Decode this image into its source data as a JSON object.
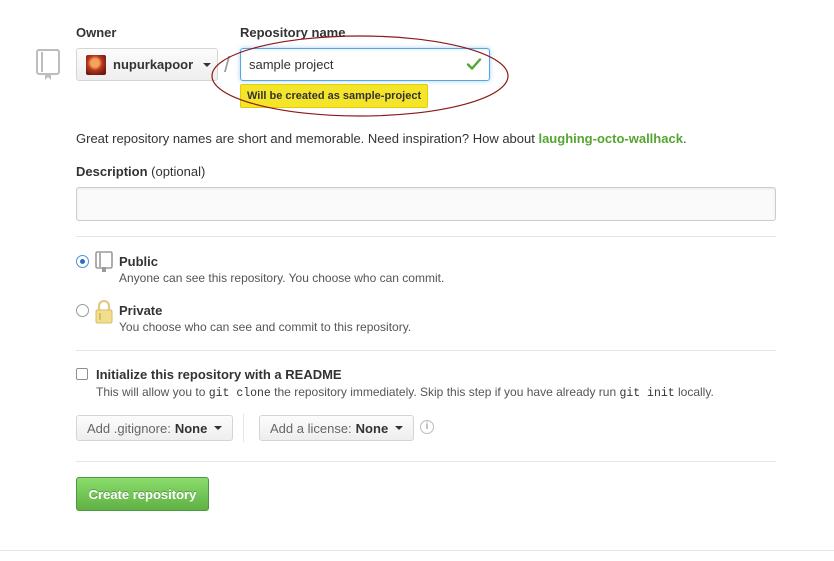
{
  "owner": {
    "label": "Owner",
    "selected": "nupurkapoor"
  },
  "repository_name": {
    "label": "Repository name",
    "value": "sample project",
    "hint": "Will be created as sample-project"
  },
  "separator": "/",
  "suggestion": {
    "text": "Great repository names are short and memorable. Need inspiration? How about ",
    "name": "laughing-octo-wallhack",
    "end": "."
  },
  "description": {
    "label": "Description",
    "optional": "(optional)",
    "value": ""
  },
  "visibility": {
    "public": {
      "title": "Public",
      "subtitle": "Anyone can see this repository. You choose who can commit.",
      "checked": true
    },
    "private": {
      "title": "Private",
      "subtitle": "You choose who can see and commit to this repository.",
      "checked": false
    }
  },
  "readme": {
    "title": "Initialize this repository with a README",
    "sub_1": "This will allow you to ",
    "code_1": "git clone",
    "sub_2": " the repository immediately. Skip this step if you have already run ",
    "code_2": "git init",
    "sub_3": " locally.",
    "checked": false
  },
  "gitignore": {
    "label": "Add .gitignore:",
    "value": "None"
  },
  "license": {
    "label": "Add a license:",
    "value": "None"
  },
  "info_icon_glyph": "i",
  "create_button": "Create repository",
  "colors": {
    "create_button": "#6cc644",
    "suggestion_link": "#55a532",
    "hint_bg": "#f5e52a",
    "annotation_ellipse": "#8b1a1a"
  }
}
